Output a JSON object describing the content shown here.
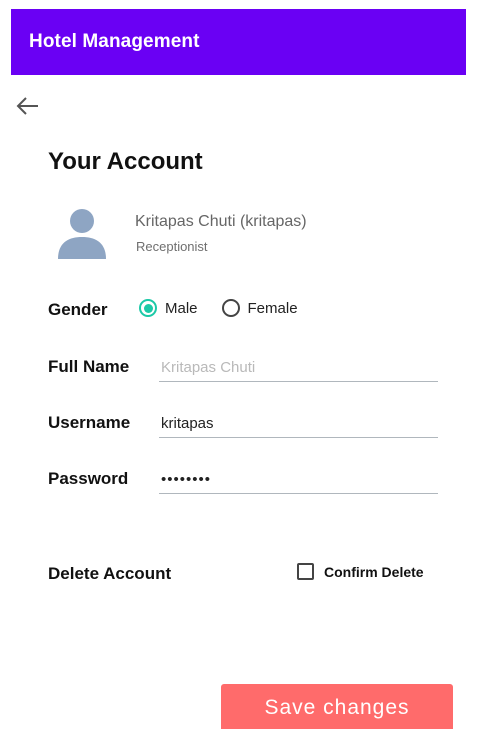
{
  "appbar": {
    "title": "Hotel Management",
    "color": "#6a00f4"
  },
  "page": {
    "title": "Your Account",
    "back_icon": "arrow-left-icon"
  },
  "user": {
    "display_name": "Kritapas Chuti (kritapas)",
    "role": "Receptionist",
    "avatar_icon": "person-icon"
  },
  "gender": {
    "label": "Gender",
    "options": [
      "Male",
      "Female"
    ],
    "selected": "Male",
    "accent_color": "#1cc9a7"
  },
  "full_name": {
    "label": "Full Name",
    "value": "",
    "placeholder": "Kritapas Chuti"
  },
  "username": {
    "label": "Username",
    "value": "kritapas"
  },
  "password": {
    "label": "Password",
    "value": "kritapas"
  },
  "delete_account": {
    "label": "Delete Account",
    "confirm_label": "Confirm Delete",
    "confirmed": false
  },
  "actions": {
    "save_label": "Save changes",
    "save_color": "#ff6b6b"
  }
}
